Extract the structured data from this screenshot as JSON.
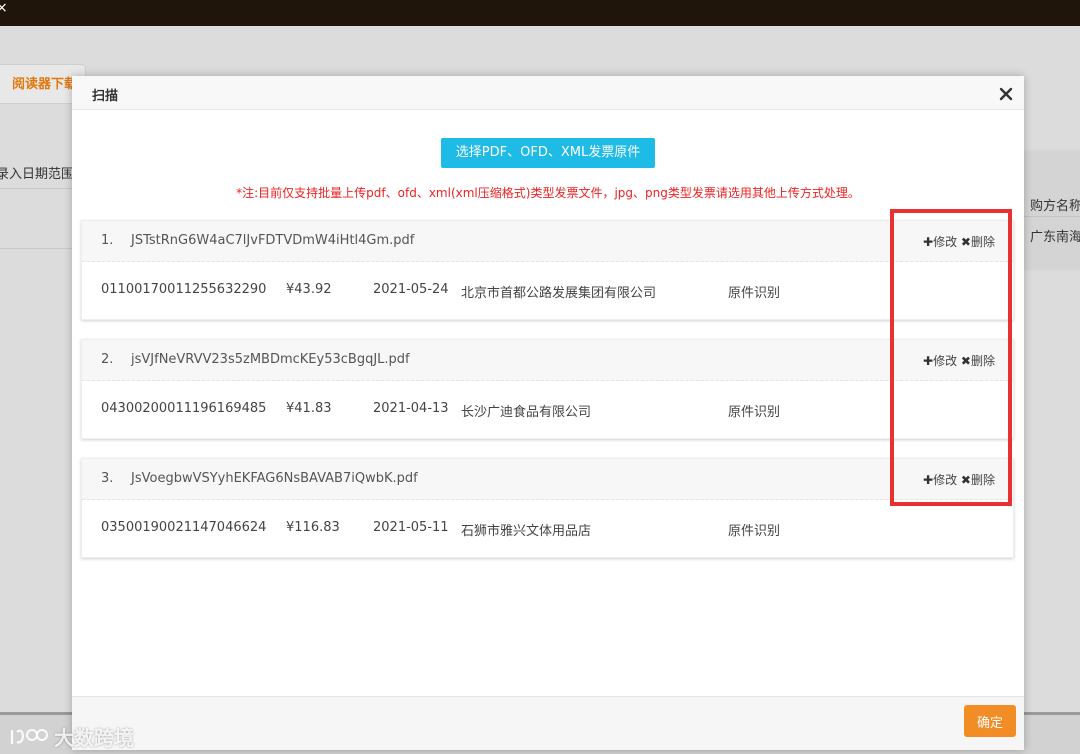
{
  "background": {
    "topbar_close": "×",
    "reader_button": "阅读器下载",
    "date_range_label": "录入日期范围",
    "table_header": "购方名称",
    "table_cell": "广东南海"
  },
  "modal": {
    "title": "扫描",
    "upload_button": "选择PDF、OFD、XML发票原件",
    "note": "*注:目前仅支持批量上传pdf、ofd、xml(xml压缩格式)类型发票文件，jpg、png类型发票请选用其他上传方式处理。",
    "edit_label": "修改",
    "delete_label": "删除",
    "invoices": [
      {
        "index": "1.",
        "filename": "JSTstRnG6W4aC7lJvFDTVDmW4iHtl4Gm.pdf",
        "code": "01100170011255632290",
        "amount": "¥43.92",
        "date": "2021-05-24",
        "seller": "北京市首都公路发展集团有限公司",
        "type": "原件识别"
      },
      {
        "index": "2.",
        "filename": "jsVJfNeVRVV23s5zMBDmcKEy53cBgqJL.pdf",
        "code": "04300200011196169485",
        "amount": "¥41.83",
        "date": "2021-04-13",
        "seller": "长沙广迪食品有限公司",
        "type": "原件识别"
      },
      {
        "index": "3.",
        "filename": "JsVoegbwVSYyhEKFAG6NsBAVAB7iQwbK.pdf",
        "code": "03500190021147046624",
        "amount": "¥116.83",
        "date": "2021-05-11",
        "seller": "石狮市雅兴文体用品店",
        "type": "原件识别"
      }
    ],
    "ok_button": "确定"
  },
  "watermark": "大数跨境",
  "colors": {
    "accent_blue": "#1ebbe6",
    "note_red": "#ee2222",
    "highlight_red": "#e83131",
    "ok_orange": "#f28c25"
  }
}
